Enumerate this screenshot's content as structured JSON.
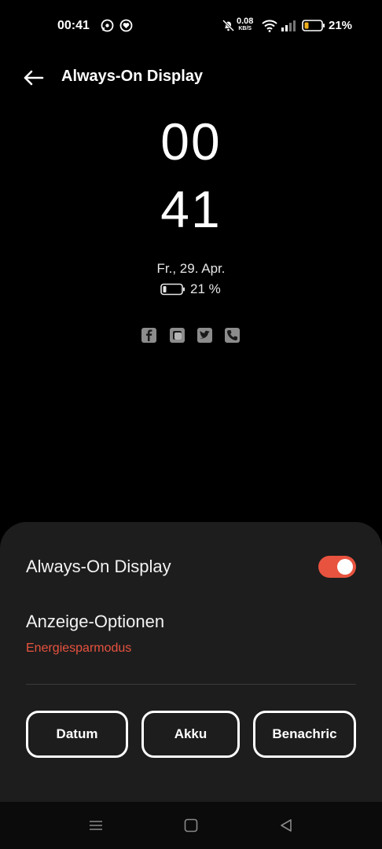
{
  "status_bar": {
    "time": "00:41",
    "net_speed_value": "0.08",
    "net_speed_unit": "KB/S",
    "battery_percent": "21%",
    "icons": [
      "whatsapp-icon",
      "heart-chat-icon",
      "mute-bell-icon",
      "wifi-icon",
      "signal-icon",
      "battery-icon"
    ]
  },
  "header": {
    "title": "Always-On Display"
  },
  "preview": {
    "hour": "00",
    "minute": "41",
    "date": "Fr., 29. Apr.",
    "battery": "21 %",
    "notification_icons": [
      "facebook-icon",
      "message-icon",
      "twitter-icon",
      "phone-icon"
    ]
  },
  "settings": {
    "aod_label": "Always-On Display",
    "aod_enabled": true,
    "display_options_label": "Anzeige-Optionen",
    "display_options_value": "Energiesparmodus",
    "buttons": [
      "Datum",
      "Akku",
      "Benachric"
    ]
  },
  "nav_bar": {
    "icons": [
      "menu-icon",
      "home-icon",
      "back-icon"
    ]
  },
  "colors": {
    "accent": "#e8533f",
    "sheet_bg": "#1d1d1d",
    "background": "#000000"
  }
}
